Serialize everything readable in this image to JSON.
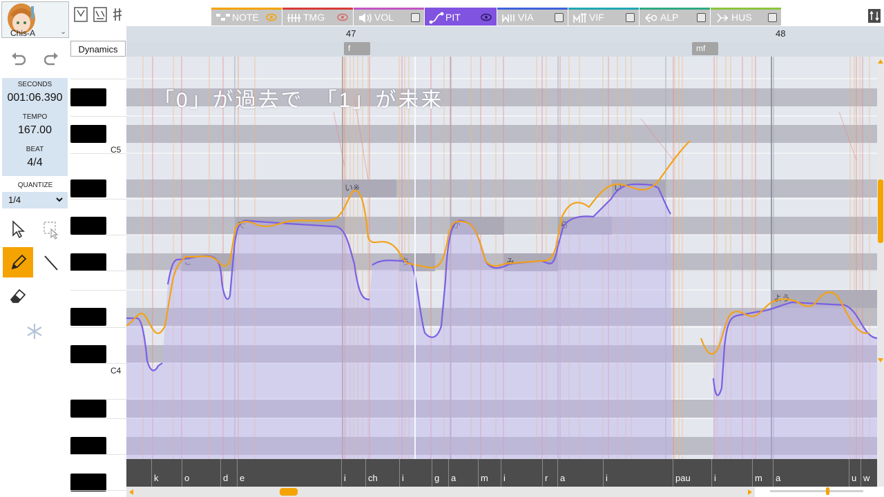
{
  "singer": {
    "name": "Chis-A"
  },
  "transport": {
    "seconds_label": "SECONDS",
    "seconds_value": "001:06.390",
    "tempo_label": "TEMPO",
    "tempo_value": "167.00",
    "beat_label": "BEAT",
    "beat_value": "4/4"
  },
  "quantize": {
    "label": "QUANTIZE",
    "value": "1/4"
  },
  "tools": [
    "pointer-tool",
    "range-select-tool",
    "pencil-tool",
    "line-tool",
    "eraser-tool",
    "freeze-tool"
  ],
  "active_tool": "pencil-tool",
  "tabs": [
    {
      "label": "NOTE",
      "color": "#f5a300",
      "active": false
    },
    {
      "label": "TMG",
      "color": "#d83b3b",
      "active": false
    },
    {
      "label": "VOL",
      "color": "#c254c4",
      "active": false
    },
    {
      "label": "PIT",
      "color": "#8053e0",
      "active": true
    },
    {
      "label": "VIA",
      "color": "#3d62d8",
      "active": false
    },
    {
      "label": "VIF",
      "color": "#20a8b4",
      "active": false
    },
    {
      "label": "ALP",
      "color": "#2fa882",
      "active": false
    },
    {
      "label": "HUS",
      "color": "#8cc43e",
      "active": false
    }
  ],
  "ruler": {
    "bars": [
      "47",
      "48"
    ]
  },
  "dynamics": {
    "label": "Dynamics",
    "marks": [
      "f",
      "mf"
    ]
  },
  "keyboard": {
    "c_labels": [
      "C5",
      "C4"
    ]
  },
  "subtitle": "「0」が過去で　「1」が未来",
  "notes": [
    {
      "lyric": "こ"
    },
    {
      "lyric": "で"
    },
    {
      "lyric": "い※"
    },
    {
      "lyric": "ち"
    },
    {
      "lyric": "が"
    },
    {
      "lyric": "み"
    },
    {
      "lyric": "ら"
    },
    {
      "lyric": "い"
    },
    {
      "lyric": "よう"
    }
  ],
  "phonemes": [
    "k",
    "o",
    "d",
    "e",
    "i",
    "ch",
    "i",
    "g",
    "a",
    "m",
    "i",
    "r",
    "a",
    "i",
    "pau",
    "i",
    "m",
    "a",
    "u",
    "w"
  ]
}
